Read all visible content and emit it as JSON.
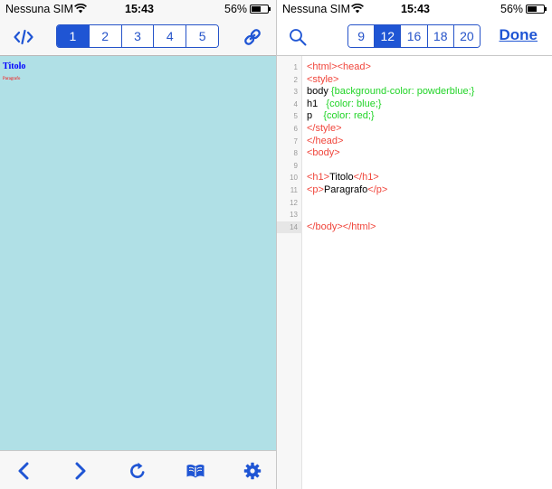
{
  "status_bar": {
    "carrier": "Nessuna SIM",
    "time": "15:43",
    "battery": "56%",
    "battery_level": 0.56
  },
  "left_toolbar": {
    "tabs": [
      "1",
      "2",
      "3",
      "4",
      "5"
    ],
    "active_tab": "1"
  },
  "preview": {
    "heading": "Titolo",
    "paragraph": "Paragrafo",
    "background": "#b0e0e6",
    "heading_color": "#0000ff",
    "paragraph_color": "#ff0000"
  },
  "right_toolbar": {
    "font_sizes": [
      "9",
      "12",
      "16",
      "18",
      "20"
    ],
    "active_size": "12",
    "done_label": "Done"
  },
  "editor": {
    "current_line": "14",
    "lines": [
      {
        "n": "1",
        "tokens": [
          {
            "t": "tag",
            "v": "<html><head>"
          }
        ]
      },
      {
        "n": "2",
        "tokens": [
          {
            "t": "tag",
            "v": "<style>"
          }
        ]
      },
      {
        "n": "3",
        "tokens": [
          {
            "t": "text",
            "v": "body "
          },
          {
            "t": "css",
            "v": "{background-color: powderblue;}"
          }
        ]
      },
      {
        "n": "4",
        "tokens": [
          {
            "t": "text",
            "v": "h1   "
          },
          {
            "t": "css",
            "v": "{color: blue;}"
          }
        ]
      },
      {
        "n": "5",
        "tokens": [
          {
            "t": "text",
            "v": "p    "
          },
          {
            "t": "css",
            "v": "{color: red;}"
          }
        ]
      },
      {
        "n": "6",
        "tokens": [
          {
            "t": "tag",
            "v": "</style>"
          }
        ]
      },
      {
        "n": "7",
        "tokens": [
          {
            "t": "tag",
            "v": "</head>"
          }
        ]
      },
      {
        "n": "8",
        "tokens": [
          {
            "t": "tag",
            "v": "<body>"
          }
        ]
      },
      {
        "n": "9",
        "tokens": []
      },
      {
        "n": "10",
        "tokens": [
          {
            "t": "tag",
            "v": "<h1>"
          },
          {
            "t": "text",
            "v": "Titolo"
          },
          {
            "t": "tag",
            "v": "</h1>"
          }
        ]
      },
      {
        "n": "11",
        "tokens": [
          {
            "t": "tag",
            "v": "<p>"
          },
          {
            "t": "text",
            "v": "Paragrafo"
          },
          {
            "t": "tag",
            "v": "</p>"
          }
        ]
      },
      {
        "n": "12",
        "tokens": []
      },
      {
        "n": "13",
        "tokens": []
      },
      {
        "n": "14",
        "tokens": [
          {
            "t": "tag",
            "v": "</body></html>"
          }
        ]
      }
    ]
  },
  "icons": {
    "left_toolbar": [
      "code-icon",
      "link-icon"
    ],
    "tab_bar": [
      "back-icon",
      "forward-icon",
      "reload-icon",
      "bookmarks-icon",
      "settings-icon"
    ],
    "right_toolbar": [
      "search-icon"
    ]
  },
  "colors": {
    "accent": "#1f55d4",
    "tag": "#f0453b",
    "css": "#22d428"
  }
}
